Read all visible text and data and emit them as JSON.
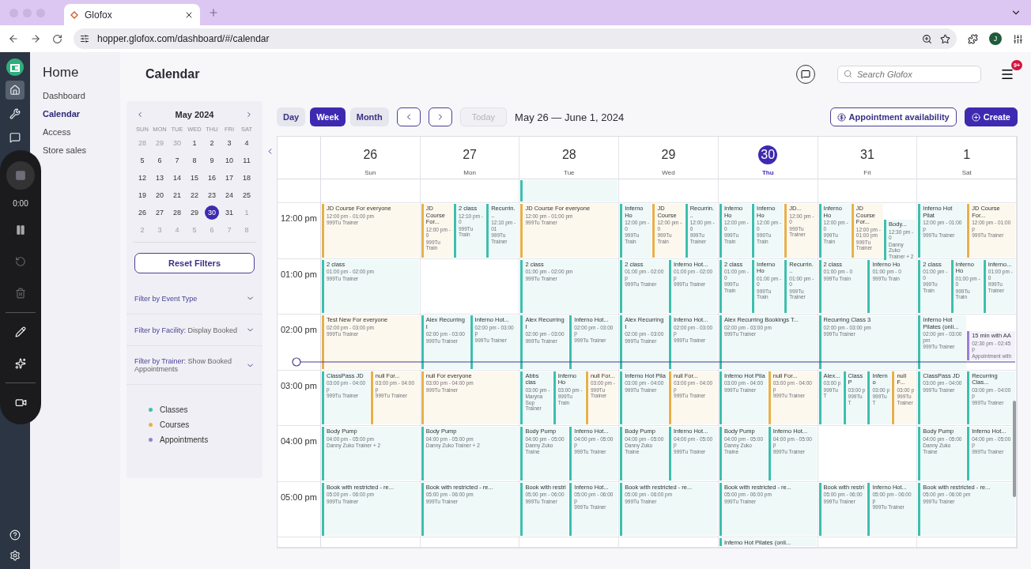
{
  "browser": {
    "tab_title": "Glofox",
    "url": "hopper.glofox.com/dashboard/#/calendar",
    "profile_initial": "J"
  },
  "rail": {
    "items": [
      {
        "kind": "home",
        "selected": true
      },
      {
        "kind": "tools",
        "selected": false
      },
      {
        "kind": "chat",
        "selected": false
      }
    ]
  },
  "recorder": {
    "time": "0:00"
  },
  "nav": {
    "title": "Home",
    "items": [
      {
        "label": "Dashboard",
        "selected": false
      },
      {
        "label": "Calendar",
        "selected": true
      },
      {
        "label": "Access",
        "selected": false
      },
      {
        "label": "Store sales",
        "selected": false
      }
    ]
  },
  "page": {
    "title": "Calendar",
    "search": {
      "placeholder": "Search Glofox"
    },
    "notifications_badge": "9+"
  },
  "mini_calendar": {
    "month": "May 2024",
    "weekdays": [
      "SUN",
      "MON",
      "TUE",
      "WED",
      "THU",
      "FRI",
      "SAT"
    ],
    "weeks": [
      [
        {
          "label": "28",
          "muted": true,
          "selected": false
        },
        {
          "label": "29",
          "muted": true,
          "selected": false
        },
        {
          "label": "30",
          "muted": true,
          "selected": false
        },
        {
          "label": "1",
          "muted": false,
          "selected": false
        },
        {
          "label": "2",
          "muted": false,
          "selected": false
        },
        {
          "label": "3",
          "muted": false,
          "selected": false
        },
        {
          "label": "4",
          "muted": false,
          "selected": false
        }
      ],
      [
        {
          "label": "5",
          "muted": false,
          "selected": false
        },
        {
          "label": "6",
          "muted": false,
          "selected": false
        },
        {
          "label": "7",
          "muted": false,
          "selected": false
        },
        {
          "label": "8",
          "muted": false,
          "selected": false
        },
        {
          "label": "9",
          "muted": false,
          "selected": false
        },
        {
          "label": "10",
          "muted": false,
          "selected": false
        },
        {
          "label": "11",
          "muted": false,
          "selected": false
        }
      ],
      [
        {
          "label": "12",
          "muted": false,
          "selected": false
        },
        {
          "label": "13",
          "muted": false,
          "selected": false
        },
        {
          "label": "14",
          "muted": false,
          "selected": false
        },
        {
          "label": "15",
          "muted": false,
          "selected": false
        },
        {
          "label": "16",
          "muted": false,
          "selected": false
        },
        {
          "label": "17",
          "muted": false,
          "selected": false
        },
        {
          "label": "18",
          "muted": false,
          "selected": false
        }
      ],
      [
        {
          "label": "19",
          "muted": false,
          "selected": false
        },
        {
          "label": "20",
          "muted": false,
          "selected": false
        },
        {
          "label": "21",
          "muted": false,
          "selected": false
        },
        {
          "label": "22",
          "muted": false,
          "selected": false
        },
        {
          "label": "23",
          "muted": false,
          "selected": false
        },
        {
          "label": "24",
          "muted": false,
          "selected": false
        },
        {
          "label": "25",
          "muted": false,
          "selected": false
        }
      ],
      [
        {
          "label": "26",
          "muted": false,
          "selected": false
        },
        {
          "label": "27",
          "muted": false,
          "selected": false
        },
        {
          "label": "28",
          "muted": false,
          "selected": false
        },
        {
          "label": "29",
          "muted": false,
          "selected": false
        },
        {
          "label": "30",
          "muted": false,
          "selected": true
        },
        {
          "label": "31",
          "muted": false,
          "selected": false
        },
        {
          "label": "1",
          "muted": true,
          "selected": false
        }
      ],
      [
        {
          "label": "2",
          "muted": true,
          "selected": false
        },
        {
          "label": "3",
          "muted": true,
          "selected": false
        },
        {
          "label": "4",
          "muted": true,
          "selected": false
        },
        {
          "label": "5",
          "muted": true,
          "selected": false
        },
        {
          "label": "6",
          "muted": true,
          "selected": false
        },
        {
          "label": "7",
          "muted": true,
          "selected": false
        },
        {
          "label": "8",
          "muted": true,
          "selected": false
        }
      ]
    ]
  },
  "reset_button": "Reset Filters",
  "filters": [
    {
      "label": "Filter by Event Type"
    },
    {
      "label": "Filter by Facility:",
      "value": "Display Booked"
    },
    {
      "label": "Filter by Trainer:",
      "value": "Show Booked Appointments"
    }
  ],
  "legend": [
    {
      "label": "Classes",
      "color": "#3dbfae"
    },
    {
      "label": "Courses",
      "color": "#e8b04a"
    },
    {
      "label": "Appointments",
      "color": "#9b7fd4"
    }
  ],
  "toolbar": {
    "views": [
      {
        "label": "Day",
        "selected": false
      },
      {
        "label": "Week",
        "selected": true
      },
      {
        "label": "Month",
        "selected": false
      }
    ],
    "today": {
      "label": "Today",
      "disabled": true
    },
    "range": "May 26 — June 1, 2024",
    "actions": [
      {
        "kind": "outline",
        "label": "Appointment availability"
      },
      {
        "kind": "primary",
        "label": "Create"
      }
    ]
  },
  "rows": [
    {
      "kind": "gap"
    },
    {
      "kind": "hour",
      "label": "12:00 pm"
    },
    {
      "kind": "hour",
      "label": "01:00 pm"
    },
    {
      "kind": "hour",
      "label": "02:00 pm"
    },
    {
      "kind": "hour",
      "label": "03:00 pm"
    },
    {
      "kind": "hour",
      "label": "04:00 pm"
    },
    {
      "kind": "hour",
      "label": "05:00 pm"
    },
    {
      "kind": "end"
    }
  ],
  "days": [
    {
      "date": "26",
      "weekday": "Sun",
      "selected": false,
      "cells": [
        [],
        [
          {
            "kind": "course",
            "title": "JD Course For everyone",
            "time": "12:00 pm - 01:00 pm",
            "trainer": "999Tu Trainer"
          }
        ],
        [
          {
            "kind": "class",
            "title": "2 class",
            "time": "01:00 pm - 02:00 pm",
            "trainer": "999Tu Trainer"
          }
        ],
        [
          {
            "kind": "course",
            "title": "Test New For everyone",
            "time": "02:00 pm - 03:00 pm",
            "trainer": "999Tu Trainer"
          }
        ],
        [
          {
            "kind": "class",
            "title": "ClassPass JD",
            "time": "03:00 pm - 04:00 p",
            "trainer": "999Tu Trainer"
          },
          {
            "kind": "course",
            "title": "null For...",
            "time": "03:00 pm - 04:00 p",
            "trainer": "999Tu Trainer"
          }
        ],
        [
          {
            "kind": "class",
            "title": "Body Pump",
            "time": "04:00 pm - 05:00 pm",
            "trainer": "Danny Zuko Trainer + 2"
          }
        ],
        [
          {
            "kind": "class",
            "title": "Book with restricted - re...",
            "time": "05:00 pm - 06:00 pm",
            "trainer": "999Tu Trainer"
          }
        ],
        []
      ]
    },
    {
      "date": "27",
      "weekday": "Mon",
      "selected": false,
      "cells": [
        [],
        [
          {
            "kind": "course",
            "title": "JD Course For...",
            "time": "12:00 pm - 0",
            "trainer": "999Tu Train"
          },
          {
            "kind": "class",
            "title": "2 class",
            "time": "12:10 pm - 0",
            "trainer": "999Tu Train"
          },
          {
            "kind": "class",
            "title": "Recurrin...",
            "time": "12:10 pm - 01",
            "trainer": "999Tu Trainer"
          }
        ],
        [],
        [
          {
            "kind": "class",
            "title": "Alex Recurring I",
            "time": "02:00 pm - 03:00",
            "trainer": "999Tu Trainer"
          },
          {
            "kind": "class",
            "title": "Inferno Hot...",
            "time": "02:00 pm - 03:00 p",
            "trainer": "999Tu Trainer"
          }
        ],
        [
          {
            "kind": "course",
            "title": "null For everyone",
            "time": "03:00 pm - 04:00 pm",
            "trainer": "999Tu Trainer"
          }
        ],
        [
          {
            "kind": "class",
            "title": "Body Pump",
            "time": "04:00 pm - 05:00 pm",
            "trainer": "Danny Zuko Trainer + 2"
          }
        ],
        [
          {
            "kind": "class",
            "title": "Book with restricted - re...",
            "time": "05:00 pm - 06:00 pm",
            "trainer": "999Tu Trainer"
          }
        ],
        []
      ]
    },
    {
      "date": "28",
      "weekday": "Tue",
      "selected": false,
      "cells": [
        [
          {
            "kind": "class"
          }
        ],
        [
          {
            "kind": "course",
            "title": "JD Course For everyone",
            "time": "12:00 pm - 01:00 pm",
            "trainer": "999Tu Trainer"
          }
        ],
        [
          {
            "kind": "class",
            "title": "2 class",
            "time": "01:00 pm - 02:00 pm",
            "trainer": "999Tu Trainer"
          }
        ],
        [
          {
            "kind": "class",
            "title": "Alex Recurring I",
            "time": "02:00 pm - 03:00",
            "trainer": "999Tu Trainer"
          },
          {
            "kind": "class",
            "title": "Inferno Hot...",
            "time": "02:00 pm - 03:00 p",
            "trainer": "999Tu Trainer"
          }
        ],
        [
          {
            "kind": "class",
            "title": "Abbs clas",
            "time": "03:00 pm -",
            "trainer": "Maryna Sup Trainer"
          },
          {
            "kind": "class",
            "title": "Inferno Ho",
            "time": "03:00 pm -",
            "trainer": "999Tu Train"
          },
          {
            "kind": "course",
            "title": "null For...",
            "time": "03:00 pm -",
            "trainer": "999Tu Trainer"
          }
        ],
        [
          {
            "kind": "class",
            "title": "Body Pump",
            "time": "04:00 pm - 05:00",
            "trainer": "Danny Zuko Traine"
          },
          {
            "kind": "class",
            "title": "Inferno Hot...",
            "time": "04:00 pm - 05:00 p",
            "trainer": "999Tu Trainer"
          }
        ],
        [
          {
            "kind": "class",
            "title": "Book with restri",
            "time": "05:00 pm - 06:00",
            "trainer": "999Tu Trainer"
          },
          {
            "kind": "class",
            "title": "Inferno Hot...",
            "time": "05:00 pm - 06:00 p",
            "trainer": "999Tu Trainer"
          }
        ],
        []
      ]
    },
    {
      "date": "29",
      "weekday": "Wed",
      "selected": false,
      "cells": [
        [],
        [
          {
            "kind": "class",
            "title": "Inferno Ho",
            "time": "12:00 pm - 0",
            "trainer": "999Tu Train"
          },
          {
            "kind": "course",
            "title": "JD Course",
            "time": "12:00 pm - 0",
            "trainer": "999Tu Train"
          },
          {
            "kind": "class",
            "title": "Recurrin...",
            "time": "12:00 pm - 0",
            "trainer": "999Tu Trainer"
          }
        ],
        [
          {
            "kind": "class",
            "title": "2 class",
            "time": "01:00 pm - 02:00 p",
            "trainer": "999Tu Trainer"
          },
          {
            "kind": "class",
            "title": "Inferno Hot...",
            "time": "01:00 pm - 02:00 p",
            "trainer": "999Tu Trainer"
          }
        ],
        [
          {
            "kind": "class",
            "title": "Alex Recurring I",
            "time": "02:00 pm - 03:00",
            "trainer": "999Tu Trainer"
          },
          {
            "kind": "class",
            "title": "Inferno Hot...",
            "time": "02:00 pm - 03:00 p",
            "trainer": "999Tu Trainer"
          }
        ],
        [
          {
            "kind": "class",
            "title": "Inferno Hot Pila",
            "time": "03:00 pm - 04:00",
            "trainer": "999Tu Trainer"
          },
          {
            "kind": "course",
            "title": "null For...",
            "time": "03:00 pm - 04:00 p",
            "trainer": "999Tu Trainer"
          }
        ],
        [
          {
            "kind": "class",
            "title": "Body Pump",
            "time": "04:00 pm - 05:00",
            "trainer": "Danny Zuko Traine"
          },
          {
            "kind": "class",
            "title": "Inferno Hot...",
            "time": "04:00 pm - 05:00 p",
            "trainer": "999Tu Trainer"
          }
        ],
        [
          {
            "kind": "class",
            "title": "Book with restricted - re...",
            "time": "05:00 pm - 06:00 pm",
            "trainer": "999Tu Trainer"
          }
        ],
        []
      ]
    },
    {
      "date": "30",
      "weekday": "Thu",
      "selected": true,
      "cells": [
        [],
        [
          {
            "kind": "class",
            "title": "Inferno Ho",
            "time": "12:00 pm - 0",
            "trainer": "999Tu Train"
          },
          {
            "kind": "class",
            "title": "Inferno Ho",
            "time": "12:00 pm - 0",
            "trainer": "999Tu Train"
          },
          {
            "kind": "course",
            "title": "JD...",
            "time": "12:00 pm - 0",
            "trainer": "999Tu Trainer"
          }
        ],
        [
          {
            "kind": "class",
            "title": "2 class",
            "time": "01:00 pm - 0",
            "trainer": "999Tu Train"
          },
          {
            "kind": "class",
            "title": "Inferno Ho",
            "time": "01:00 pm - 0",
            "trainer": "999Tu Train"
          },
          {
            "kind": "class",
            "title": "Recurrin...",
            "time": "01:00 pm - 0",
            "trainer": "999Tu Trainer"
          }
        ],
        [
          {
            "kind": "class",
            "title": "Alex Recurring Bookings T...",
            "time": "02:00 pm - 03:00 pm",
            "trainer": "999Tu Trainer"
          }
        ],
        [
          {
            "kind": "class",
            "title": "Inferno Hot Pila",
            "time": "03:00 pm - 04:00",
            "trainer": "999Tu Trainer"
          },
          {
            "kind": "course",
            "title": "null For...",
            "time": "03:00 pm - 04:00 p",
            "trainer": "999Tu Trainer"
          }
        ],
        [
          {
            "kind": "class",
            "title": "Body Pump",
            "time": "04:00 pm - 05:00",
            "trainer": "Danny Zuko Traine"
          },
          {
            "kind": "class",
            "title": "Inferno Hot...",
            "time": "04:00 pm - 05:00 p",
            "trainer": "999Tu Trainer"
          }
        ],
        [
          {
            "kind": "class",
            "title": "Book with restricted - re...",
            "time": "05:00 pm - 06:00 pm",
            "trainer": "999Tu Trainer"
          }
        ],
        [
          {
            "kind": "class",
            "title": "Inferno Hot Pilates (onli..."
          }
        ]
      ]
    },
    {
      "date": "31",
      "weekday": "Fri",
      "selected": false,
      "cells": [
        [],
        [
          {
            "kind": "class",
            "title": "Inferno Ho",
            "time": "12:00 pm - 0",
            "trainer": "999Tu Train"
          },
          {
            "kind": "course",
            "title": "JD Course For...",
            "time": "12:00 pm - 01:00 pm",
            "trainer": "999Tu Trainer"
          },
          {
            "kind": "class",
            "half_past": true,
            "title": "Body...",
            "time": "12:30 pm - 0",
            "trainer": "Danny Zuko Trainer + 2"
          }
        ],
        [
          {
            "kind": "class",
            "title": "2 class",
            "time": "01:00 pm - 0",
            "trainer": "999Tu Train"
          },
          {
            "kind": "class",
            "title": "Inferno Ho",
            "time": "01:00 pm - 0",
            "trainer": "999Tu Train"
          }
        ],
        [
          {
            "kind": "class",
            "title": "Recurring Class 3",
            "time": "02:00 pm - 03:00 pm",
            "trainer": "999Tu Trainer"
          }
        ],
        [
          {
            "kind": "class",
            "title": "Alex...",
            "time": "03:00 p",
            "trainer": "999Tu T"
          },
          {
            "kind": "class",
            "title": "ClassP",
            "time": "03:00 p",
            "trainer": "999Tu T"
          },
          {
            "kind": "class",
            "title": "Inferno",
            "time": "03:00 p",
            "trainer": "999Tu T"
          },
          {
            "kind": "course",
            "title": "null F...",
            "time": "03:00 p",
            "trainer": "999Tu Trainer"
          }
        ],
        [],
        [
          {
            "kind": "class",
            "title": "Book with restri",
            "time": "05:00 pm - 06:00",
            "trainer": "999Tu Trainer"
          },
          {
            "kind": "class",
            "title": "Inferno Hot...",
            "time": "05:00 pm - 06:00 p",
            "trainer": "999Tu Trainer"
          }
        ],
        []
      ]
    },
    {
      "date": "1",
      "weekday": "Sat",
      "selected": false,
      "cells": [
        [],
        [
          {
            "kind": "class",
            "title": "Inferno Hot Pilat",
            "time": "12:00 pm - 01:00 p",
            "trainer": "999Tu Trainer"
          },
          {
            "kind": "course",
            "title": "JD Course For...",
            "time": "12:00 pm - 01:00 p",
            "trainer": "999Tu Trainer"
          }
        ],
        [
          {
            "kind": "class",
            "title": "2 class",
            "time": "01:00 pm - 0",
            "trainer": "999Tu Train"
          },
          {
            "kind": "class",
            "title": "Inferno Ho",
            "time": "01:00 pm - 0",
            "trainer": "999Tu Train"
          },
          {
            "kind": "class",
            "title": "Inferno...",
            "time": "01:00 pm - 0",
            "trainer": "999Tu Trainer"
          }
        ],
        [
          {
            "kind": "class",
            "title": "Inferno Hot Pilates (onli...",
            "time": "02:00 pm - 03:00 pm",
            "trainer": "999Tu Trainer"
          },
          {
            "kind": "appointment",
            "half_past": true,
            "title": "15 min with AA",
            "time": "02:30 pm - 02:45 p",
            "trainer": "Appointment with"
          }
        ],
        [
          {
            "kind": "class",
            "title": "ClassPass JD",
            "time": "03:00 pm - 04:00",
            "trainer": "999Tu Trainer"
          },
          {
            "kind": "class",
            "title": "Recurring Clas...",
            "time": "03:00 pm - 04:00 p",
            "trainer": "999Tu Trainer"
          }
        ],
        [
          {
            "kind": "class",
            "title": "Body Pump",
            "time": "04:00 pm - 05:00",
            "trainer": "Danny Zuko Traine"
          },
          {
            "kind": "class",
            "title": "Inferno Hot...",
            "time": "04:00 pm - 05:00 p",
            "trainer": "999Tu Trainer"
          }
        ],
        [
          {
            "kind": "class",
            "title": "Book with restricted - re...",
            "time": "05:00 pm - 06:00 pm",
            "trainer": "999Tu Trainer"
          }
        ],
        []
      ]
    }
  ]
}
